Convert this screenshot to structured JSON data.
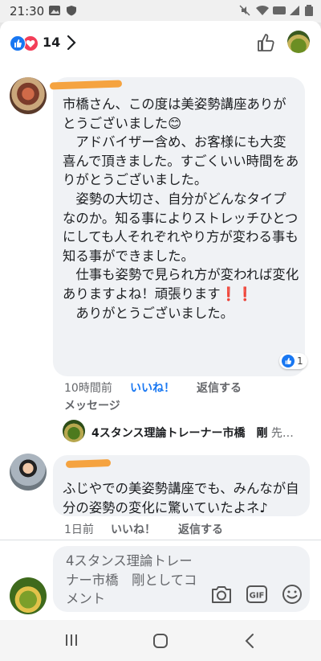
{
  "status_bar": {
    "time": "21:30"
  },
  "header": {
    "reaction_count": "14"
  },
  "comments": [
    {
      "text": "市橋さん、この度は美姿勢講座ありがとうございました😊\n　アドバイザー含め、お客様にも大変喜んで頂きました。すごくいい時間をありがとうございました。\n　姿勢の大切さ、自分がどんなタイプなのか。知る事によりストレッチひとつにしても人それぞれやり方が変わる事も知る事ができました。\n　仕事も姿勢で見られ方が変われば変化ありますよね！頑張ります❗❗\n　ありがとうございました。",
      "reaction_count": "1",
      "time": "10時間前",
      "like_label": "いいね！",
      "reply_label": "返信する",
      "message_label": "メッセージ",
      "reply_preview": {
        "name": "4スタンス理論トレーナー市橋　剛",
        "rest": " 先…"
      }
    },
    {
      "text": "ふじやでの美姿勢講座でも、みんなが自分の姿勢の変化に驚いていたよネ♪",
      "time": "1日前",
      "like_label": "いいね！",
      "reply_label": "返信する"
    }
  ],
  "composer": {
    "placeholder": "4スタンス理論トレーナー市橋　剛としてコメント",
    "gif_label": "GIF"
  },
  "colors": {
    "accent": "#1877f2",
    "love": "#f33e58",
    "bubble": "#f0f2f5"
  }
}
